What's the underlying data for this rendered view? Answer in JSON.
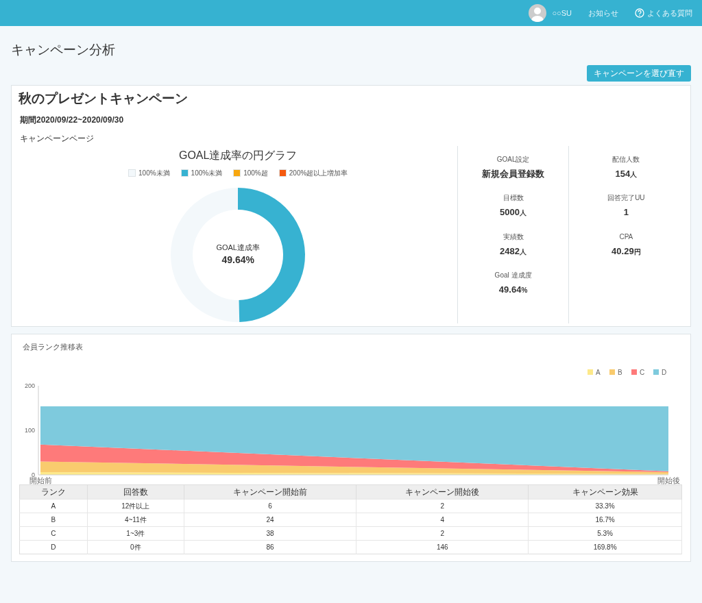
{
  "header": {
    "user": "○○SU",
    "links": [
      {
        "label": "お知らせ",
        "kind": "plain"
      },
      {
        "label": "よくある質問",
        "kind": "help"
      }
    ]
  },
  "page_title": "キャンペーン分析",
  "reselect_button": "キャンペーンを選び直す",
  "campaign": {
    "name": "秋のプレゼントキャンペーン",
    "period": "期間2020/09/22~2020/09/30",
    "section": "キャンペーンページ",
    "goal_chart": {
      "center_label": "GOAL達成率",
      "center_value": "49.64%",
      "chart_data": {
        "type": "donut",
        "title": "GOAL達成率の円グラフ",
        "categories": [
          "100%未満",
          "100%未満",
          "100%超",
          "200%超以上増加率"
        ],
        "values": [
          50.36,
          49.64,
          0,
          0
        ],
        "colors": [
          "#f3f8fb",
          "#37b2d1",
          "#f8a70f",
          "#f55a0f"
        ]
      }
    },
    "stat_columns": [
      [
        {
          "label": "GOAL設定",
          "value": "新規会員登録数"
        },
        {
          "label": "目標数",
          "value": "5000",
          "unit": "人"
        },
        {
          "label": "実績数",
          "value": "2482",
          "unit": "人"
        },
        {
          "label": "Goal 達成度",
          "value": "49.64",
          "unit": "%"
        }
      ],
      [
        {
          "label": "配信人数",
          "value": "154",
          "unit": "人"
        },
        {
          "label": "回答完了UU",
          "value": "1"
        },
        {
          "label": "CPA",
          "value": "40.29",
          "unit": "円"
        }
      ]
    ]
  },
  "rank_panel": {
    "title": "会員ランク推移表",
    "chart_data": {
      "type": "area",
      "stacked": true,
      "legend": true,
      "categories": [
        "開始前",
        "開始後"
      ],
      "ylim": [
        0,
        200
      ],
      "yticks": [
        0,
        100,
        200
      ],
      "series": [
        {
          "name": "A",
          "color": "#fde98a",
          "values": [
            6,
            2
          ]
        },
        {
          "name": "B",
          "color": "#f9cb6e",
          "values": [
            24,
            4
          ]
        },
        {
          "name": "C",
          "color": "#fe7a7a",
          "values": [
            38,
            2
          ]
        },
        {
          "name": "D",
          "color": "#7ecadd",
          "values": [
            86,
            146
          ]
        }
      ]
    },
    "table": {
      "columns": [
        "ランク",
        "回答数",
        "キャンペーン開始前",
        "キャンペーン開始後",
        "キャンペーン効果"
      ],
      "rows": [
        [
          "A",
          "12件以上",
          "6",
          "2",
          "33.3%"
        ],
        [
          "B",
          "4~11件",
          "24",
          "4",
          "16.7%"
        ],
        [
          "C",
          "1~3件",
          "38",
          "2",
          "5.3%"
        ],
        [
          "D",
          "0件",
          "86",
          "146",
          "169.8%"
        ]
      ]
    }
  }
}
